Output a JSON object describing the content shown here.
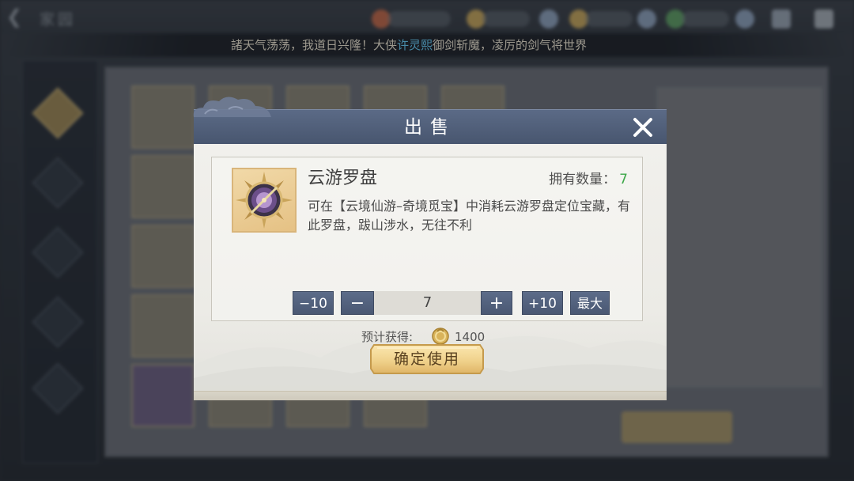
{
  "background": {
    "page_title": "家园",
    "ticker_prefix": "諸天气荡荡，我道日兴隆！大侠",
    "ticker_name": "许灵熙",
    "ticker_suffix": "御剑斩魔，凌厉的剑气将世界"
  },
  "dialog": {
    "title": "出售",
    "item": {
      "name": "云游罗盘",
      "owned_label": "拥有数量：",
      "owned_count": "7",
      "description": "可在【云境仙游–奇境觅宝】中消耗云游罗盘定位宝藏，有此罗盘，跋山涉水，无往不利"
    },
    "quantity": {
      "minus10_label": "−10",
      "minus_label": "−",
      "value": "7",
      "plus_label": "+",
      "plus10_label": "+10",
      "max_label": "最大"
    },
    "expected": {
      "label": "预计获得:",
      "value": "1400"
    },
    "confirm_label": "确定使用"
  },
  "colors": {
    "header": "#4f5d78",
    "button_blue": "#52617d",
    "owned_count": "#3ea84a",
    "confirm_gold": "#f0d28c",
    "ticker_highlight": "#6ad4ff"
  }
}
